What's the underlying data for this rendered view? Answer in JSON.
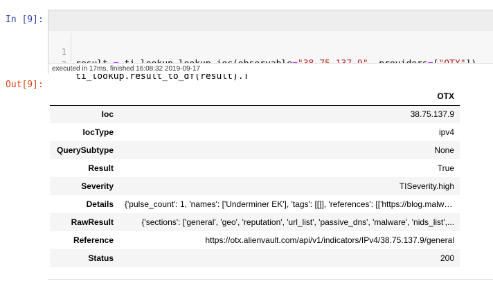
{
  "input_prompt": "In [9]:",
  "output_prompt": "Out[9]:",
  "code": {
    "lines": [
      {
        "number": "1",
        "tokens": [
          "result ",
          "=",
          " ti_lookup.lookup_ioc(observable",
          "=",
          "\"38.75.137.9\"",
          ", providers",
          "=",
          "[",
          "\"OTX\"",
          "])"
        ]
      },
      {
        "number": "2",
        "tokens": [
          "ti_lookup.result_to_df(result).T"
        ]
      }
    ]
  },
  "execution_info": "executed in 17ms, finished 16:08:32 2019-09-17",
  "table": {
    "column_header": "OTX",
    "rows": [
      {
        "label": "Ioc",
        "value": "38.75.137.9"
      },
      {
        "label": "IocType",
        "value": "ipv4"
      },
      {
        "label": "QuerySubtype",
        "value": "None"
      },
      {
        "label": "Result",
        "value": "True"
      },
      {
        "label": "Severity",
        "value": "TISeverity.high"
      },
      {
        "label": "Details",
        "value": "{'pulse_count': 1, 'names': ['Underminer EK'], 'tags': [[]], 'references': [['https://blog.malwa..."
      },
      {
        "label": "RawResult",
        "value": "{'sections': ['general', 'geo', 'reputation', 'url_list', 'passive_dns', 'malware', 'nids_list',..."
      },
      {
        "label": "Reference",
        "value": "https://otx.alienvault.com/api/v1/indicators/IPv4/38.75.137.9/general"
      },
      {
        "label": "Status",
        "value": "200"
      }
    ]
  },
  "colors": {
    "input_prompt": "#303f9f",
    "output_prompt": "#d84315",
    "string_token": "#ba2121",
    "operator_token": "#aa22ff",
    "cell_background": "#f7f7f7"
  }
}
